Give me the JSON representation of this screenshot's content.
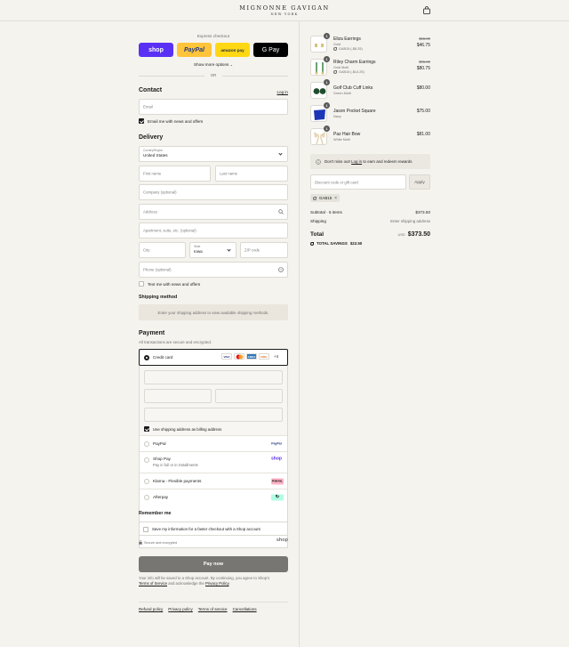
{
  "header": {
    "brand": "MIGNONNE GAVIGAN",
    "brand_sub": "NEW YORK"
  },
  "express": {
    "title": "Express checkout",
    "buttons": [
      {
        "label": "shop",
        "bg": "#5a31f4",
        "fg": "#ffffff"
      },
      {
        "label": "PayPal",
        "bg": "#ffc439",
        "fg": "#253b80"
      },
      {
        "label": "amazon pay",
        "bg": "#ffd814",
        "fg": "#232f3e"
      },
      {
        "label": "G Pay",
        "bg": "#000000",
        "fg": "#ffffff"
      }
    ],
    "show_more": "Show more options",
    "or": "OR"
  },
  "contact": {
    "title": "Contact",
    "login": "Log in",
    "email_placeholder": "Email",
    "email_news": "Email me with news and offers"
  },
  "delivery": {
    "title": "Delivery",
    "country_label": "Country/Region",
    "country_value": "United States",
    "first_name": "First name",
    "last_name": "Last name",
    "company": "Company (optional)",
    "address": "Address",
    "apartment": "Apartment, suite, etc. (optional)",
    "city": "City",
    "state_label": "State",
    "state_value": "Iowa",
    "zip": "ZIP code",
    "phone": "Phone (optional)",
    "text_news": "Text me with news and offers"
  },
  "shipping": {
    "title": "Shipping method",
    "message": "Enter your shipping address to view available shipping methods."
  },
  "payment": {
    "title": "Payment",
    "subtitle": "All transactions are secure and encrypted.",
    "credit_card": "Credit card",
    "card_brands": [
      {
        "label": "VISA",
        "bg": "#ffffff",
        "fg": "#1a1f71"
      },
      {
        "label": "",
        "bg": "#ffffff",
        "fg": "#eb001b"
      },
      {
        "label": "AMEX",
        "bg": "#2e77bc",
        "fg": "#ffffff"
      },
      {
        "label": "DISC",
        "bg": "#ffffff",
        "fg": "#e06a1b"
      }
    ],
    "more_brands": "+4",
    "billing_same": "Use shipping address as billing address",
    "methods": [
      {
        "label": "PayPal",
        "sub": "",
        "badge": "PayPal",
        "badge_bg": "#ffffff",
        "badge_fg": "#253b80"
      },
      {
        "label": "Shop Pay",
        "sub": "Pay in full or in installments",
        "badge": "shop",
        "badge_bg": "#ffffff",
        "badge_fg": "#5a31f4"
      },
      {
        "label": "Klarna - Flexible payments",
        "sub": "",
        "badge": "Klarna.",
        "badge_bg": "#ffb3c7",
        "badge_fg": "#17120f"
      },
      {
        "label": "Afterpay",
        "sub": "",
        "badge": "↻",
        "badge_bg": "#b2fce4",
        "badge_fg": "#000000"
      }
    ]
  },
  "remember": {
    "title": "Remember me",
    "save_info": "Save my information for a faster checkout with a Shop account",
    "secure": "Secure and encrypted",
    "shop": "shop"
  },
  "pay_now": "Pay now",
  "legal": {
    "line1": "Your info will be saved to a Shop account. By continuing, you agree to Shop's",
    "terms": "Terms of Service",
    "and_ack": " and acknowledge the ",
    "privacy": "Privacy Policy",
    "period": "."
  },
  "footer_links": [
    "Refund policy",
    "Privacy policy",
    "Terms of service",
    "Cancellations"
  ],
  "cart": {
    "items": [
      {
        "name": "Eliza Earrings",
        "variant": "Gold",
        "discount": "GAB15 (-$8.25)",
        "old_price": "$55.00",
        "price": "$46.75",
        "qty": "1"
      },
      {
        "name": "Riley Charm Earrings",
        "variant": "Gold Multi",
        "discount": "GAB15 (-$14.25)",
        "old_price": "$95.00",
        "price": "$80.75",
        "qty": "1"
      },
      {
        "name": "Golf Club Cuff Links",
        "variant": "Green Multi",
        "discount": "",
        "old_price": "",
        "price": "$80.00",
        "qty": "1"
      },
      {
        "name": "Jason Pocket Square",
        "variant": "Navy",
        "discount": "",
        "old_price": "",
        "price": "$75.00",
        "qty": "1"
      },
      {
        "name": "Paz Hair Bow",
        "variant": "White Multi",
        "discount": "",
        "old_price": "",
        "price": "$81.00",
        "qty": "1"
      }
    ],
    "rewards_prefix": "Don't miss out! ",
    "rewards_link": "Log in",
    "rewards_suffix": " to earn and redeem rewards",
    "discount_placeholder": "Discount code or gift card",
    "apply": "Apply",
    "code": "GAB15",
    "subtotal_label": "Subtotal · 5 items",
    "subtotal_value": "$373.50",
    "shipping_label": "Shipping",
    "shipping_value": "Enter shipping address",
    "total_label": "Total",
    "currency": "USD",
    "total_value": "$373.50",
    "savings_label": "TOTAL SAVINGS",
    "savings_value": "$22.50"
  }
}
